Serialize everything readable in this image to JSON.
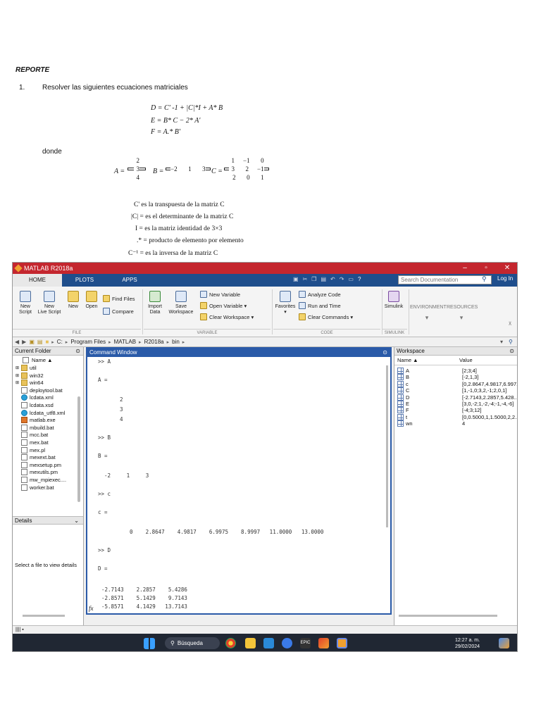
{
  "doc": {
    "heading": "REPORTE",
    "question_number": "1.",
    "question_text": "Resolver las siguientes ecuaciones matriciales",
    "equations": [
      "D = C' -1 + |C|*I + A* B",
      "E = B* C − 2* A'",
      "F = A.* B'"
    ],
    "donde": "donde",
    "matrix_A": {
      "label": "A =",
      "rows": [
        [
          "2"
        ],
        [
          "3"
        ],
        [
          "4"
        ]
      ]
    },
    "matrix_B": {
      "label": "B =",
      "rows": [
        [
          "−2",
          "1",
          "3"
        ]
      ]
    },
    "matrix_C": {
      "label": "C =",
      "rows": [
        [
          "1",
          "−1",
          "0"
        ],
        [
          "3",
          "2",
          "−1"
        ],
        [
          "2",
          "0",
          "1"
        ]
      ]
    },
    "definitions": [
      "C'   es la transpuesta de la matriz C",
      "|C| = es el determinante de la matriz C",
      "I = es la matriz identidad de 3×3",
      ".* = producto de elemento por elemento",
      "C⁻¹ = es la inversa de la matriz C"
    ]
  },
  "matlab": {
    "title": "MATLAB R2018a",
    "tabs": [
      "HOME",
      "PLOTS",
      "APPS"
    ],
    "search_placeholder": "Search Documentation",
    "login": "Log In",
    "ribbon": {
      "new_script": "New\nScript",
      "new_live_script": "New\nLive Script",
      "new": "New",
      "open": "Open",
      "find_files": "Find Files",
      "compare": "Compare",
      "import_data": "Import\nData",
      "save_workspace": "Save\nWorkspace",
      "new_variable": "New Variable",
      "open_variable": "Open Variable ▾",
      "clear_workspace": "Clear Workspace ▾",
      "favorites": "Favorites",
      "analyze_code": "Analyze Code",
      "run_and_time": "Run and Time",
      "clear_commands": "Clear Commands ▾",
      "simulink": "Simulink",
      "environment": "ENVIRONMENT",
      "resources": "RESOURCES",
      "sections": [
        "FILE",
        "VARIABLE",
        "CODE",
        "SIMULINK"
      ]
    },
    "address": [
      "C:",
      "Program Files",
      "MATLAB",
      "R2018a",
      "bin"
    ],
    "current_folder": {
      "title": "Current Folder",
      "name_header": "Name ▲",
      "files": [
        {
          "name": "util",
          "type": "folder"
        },
        {
          "name": "win32",
          "type": "folder"
        },
        {
          "name": "win64",
          "type": "folder"
        },
        {
          "name": "deploytool.bat",
          "type": "bat"
        },
        {
          "name": "lcdata.xml",
          "type": "xml"
        },
        {
          "name": "lcdata.xsd",
          "type": "file"
        },
        {
          "name": "lcdata_utf8.xml",
          "type": "xml"
        },
        {
          "name": "matlab.exe",
          "type": "exe"
        },
        {
          "name": "mbuild.bat",
          "type": "bat"
        },
        {
          "name": "mcc.bat",
          "type": "bat"
        },
        {
          "name": "mex.bat",
          "type": "bat"
        },
        {
          "name": "mex.pl",
          "type": "file"
        },
        {
          "name": "mexext.bat",
          "type": "bat"
        },
        {
          "name": "mexsetup.pm",
          "type": "file"
        },
        {
          "name": "mexutils.pm",
          "type": "file"
        },
        {
          "name": "mw_mpiexec....",
          "type": "bat"
        },
        {
          "name": "worker.bat",
          "type": "bat"
        }
      ],
      "details": "Details",
      "details_text": "Select a file to view details"
    },
    "command_window": {
      "title": "Command Window",
      "lines": [
        ">> A",
        "A =",
        "2",
        "3",
        "4",
        ">> B",
        "B =",
        "-2     1     3",
        ">> c",
        "c =",
        "0    2.8647    4.9817    6.9975    8.9997   11.0000   13.0000",
        ">> D",
        "D =",
        "-2.7143    2.2857    5.4286",
        "-2.8571    5.1429    9.7143",
        "-5.8571    4.1429   13.7143"
      ],
      "prompt": "fx"
    },
    "workspace": {
      "title": "Workspace",
      "name_header": "Name ▲",
      "value_header": "Value",
      "vars": [
        {
          "name": "A",
          "value": "[2;3;4]"
        },
        {
          "name": "B",
          "value": "[-2,1,3]"
        },
        {
          "name": "c",
          "value": "[0,2.8647,4.9817,6.997..."
        },
        {
          "name": "C",
          "value": "[1,-1,0;3,2,-1;2,0,1]"
        },
        {
          "name": "D",
          "value": "[-2.7143,2.2857,5.428..."
        },
        {
          "name": "E",
          "value": "[3,0,-2;1,-2,-4;-1,-4,-6]"
        },
        {
          "name": "F",
          "value": "[-4;3;12]"
        },
        {
          "name": "t",
          "value": "[0,0.5000,1,1.5000,2,2..."
        },
        {
          "name": "wn",
          "value": "4"
        }
      ]
    },
    "status": "||||  ▪",
    "taskbar": {
      "search": "Búsqueda",
      "time": "12:27 a. m.",
      "date": "29/02/2024"
    }
  }
}
